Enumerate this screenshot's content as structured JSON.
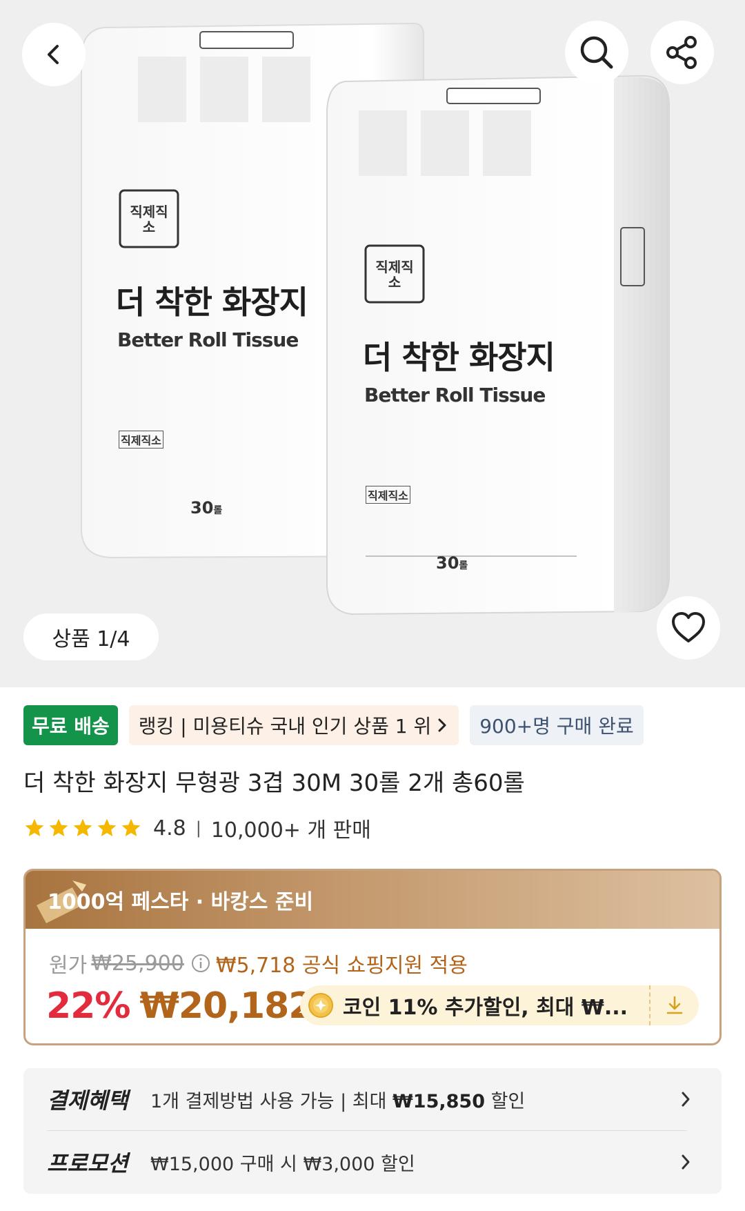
{
  "gallery": {
    "counter_label": "상품 1/4",
    "packaging": {
      "brand_logo": "직제직소",
      "product_name_ko": "더 착한 화장지",
      "product_name_en": "Better Roll Tissue",
      "brand_small": "직제직소",
      "count": "30",
      "count_unit": "롤"
    }
  },
  "icons": {
    "back": "chevron-left-icon",
    "search": "search-icon",
    "share": "share-icon",
    "like": "heart-icon"
  },
  "badges": {
    "free_shipping": "무료 배송",
    "ranking": "랭킹 | 미용티슈 국내 인기 상품 1 위",
    "purchased": "900+명 구매 완료"
  },
  "product": {
    "title": "더 착한 화장지 무형광 3겹 30M 30롤 2개 총60롤",
    "rating": 4.8,
    "rating_text": "4.8",
    "sold_text": "10,000+ 개 판매"
  },
  "price_card": {
    "promo_title": "1000억 페스타 · 바캉스 준비",
    "original_label": "원가",
    "original_price": "₩25,900",
    "support_text": "₩5,718 공식 쇼핑지원 적용",
    "discount": "22%",
    "sale_price": "₩20,182",
    "coin_text": "코인 11% 추가할인, 최대 ₩..."
  },
  "benefits": [
    {
      "label": "결제혜택",
      "text_pre": "1개 결제방법 사용 가능 | 최대 ",
      "text_bold": "₩15,850",
      "text_post": " 할인"
    },
    {
      "label": "프로모션",
      "text_pre": "₩15,000 구매 시 ₩3,000 할인",
      "text_bold": "",
      "text_post": ""
    }
  ],
  "colors": {
    "free_shipping_green": "#13944a",
    "discount_red": "#e32b3e",
    "price_brown": "#b2641b",
    "star_yellow": "#f5b800",
    "card_border": "#c6a27f"
  }
}
